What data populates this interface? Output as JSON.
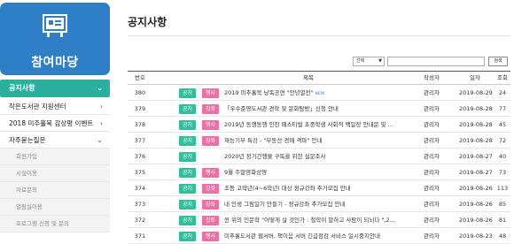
{
  "sidebar": {
    "title": "참여마당",
    "menu_head": "공지사항",
    "items": [
      {
        "label": "작은도서관 지원센터",
        "chev": "›"
      },
      {
        "label": "2018 미추홀북 감상평 이벤트",
        "chev": "›"
      },
      {
        "label": "자주묻는질문",
        "chev": "⌄"
      }
    ],
    "subitems": [
      "회원가입",
      "시설이용",
      "자료문의",
      "열람실이용",
      "프로그램 신청 및 문의"
    ]
  },
  "page_title": "공지사항",
  "search": {
    "select_value": "선택",
    "input_value": "",
    "button_label": "검색"
  },
  "table": {
    "headers": {
      "no": "번호",
      "title": "제목",
      "writer": "작성자",
      "date": "일자",
      "views": "조회"
    },
    "rows": [
      {
        "no": "380",
        "cat1": "공지",
        "cat2": "행사",
        "title": "2019 미추홀북 낭독공연 \"안녕열전\"",
        "new": "NEW",
        "writer": "관리자",
        "date": "2019-08-29",
        "views": "24"
      },
      {
        "no": "379",
        "cat1": "공지",
        "cat2": "강좌",
        "title": "「우수준영도서관 견학 및 문화탐방」신청 안내",
        "new": "",
        "writer": "관리자",
        "date": "2019-08-28",
        "views": "77"
      },
      {
        "no": "378",
        "cat1": "공지",
        "cat2": "행사",
        "title": "2019년 동행동행 인천 페스티벌 초중학생 사회적 백일장 안내문 및 ...",
        "new": "",
        "writer": "관리자",
        "date": "2019-08-28",
        "views": "45"
      },
      {
        "no": "377",
        "cat1": "공지",
        "cat2": "강좌",
        "title": "재능기부 특강 - \"부동산 경매 격파\" 안내",
        "new": "",
        "writer": "관리자",
        "date": "2019-08-28",
        "views": "72"
      },
      {
        "no": "376",
        "cat1": "공지",
        "cat2": "",
        "title": "2020년 정기간행물 구독을 위한 설문조사",
        "new": "",
        "writer": "관리자",
        "date": "2019-08-27",
        "views": "40"
      },
      {
        "no": "375",
        "cat1": "공지",
        "cat2": "행사",
        "title": "9월 주말영화상영",
        "new": "",
        "writer": "관리자",
        "date": "2019-08-27",
        "views": "73"
      },
      {
        "no": "374",
        "cat1": "공지",
        "cat2": "강좌",
        "title": "초등 고학년(4~6학년) 대상 정규강좌 추가모집 안내",
        "new": "",
        "writer": "관리자",
        "date": "2019-08-26",
        "views": "113"
      },
      {
        "no": "373",
        "cat1": "공지",
        "cat2": "강좌",
        "title": "내 인생 그림일기 만들기 - 정규강좌 추가모집 안내",
        "new": "",
        "writer": "관리자",
        "date": "2019-08-26",
        "views": "85"
      },
      {
        "no": "372",
        "cat1": "공지",
        "cat2": "강좌",
        "title": "윈 위의 인문학 \"어떻게 살 것인가 : 철학이 말하고 사람이 되뇌다 \",2...",
        "new": "",
        "writer": "관리자",
        "date": "2019-08-26",
        "views": "81"
      },
      {
        "no": "371",
        "cat1": "공지",
        "cat2": "행사",
        "title": "미추홀도서관 웹서버, 책이음 서버 긴급점검 서비스 일시중지안내",
        "new": "",
        "writer": "관리자",
        "date": "2019-08-23",
        "views": "48"
      }
    ]
  },
  "colors": {
    "brand_blue": "#2e7fc6",
    "menu_teal": "#2bb0a0",
    "badge_notice": "#2fbf9b",
    "badge_pink": "#ec6fa5"
  }
}
